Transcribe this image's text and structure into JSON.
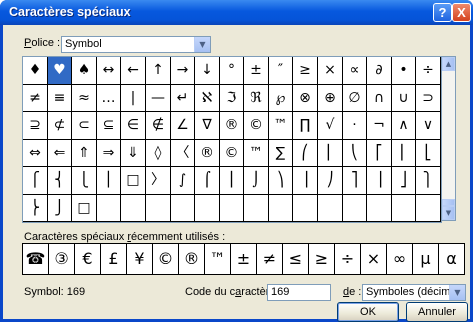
{
  "window": {
    "title": "Caractères spéciaux",
    "help_label": "?",
    "close_label": "X"
  },
  "font_row": {
    "label": "olice :",
    "label_accel": "P",
    "value": "Symbol"
  },
  "grid": {
    "rows": [
      [
        "♦",
        "♥",
        "♠",
        "↔",
        "←",
        "↑",
        "→",
        "↓",
        "°",
        "±",
        "″",
        "≥",
        "×",
        "∝",
        "∂",
        "•",
        "÷"
      ],
      [
        "≠",
        "≡",
        "≈",
        "…",
        "|",
        "—",
        "↵",
        "ℵ",
        "ℑ",
        "ℜ",
        "℘",
        "⊗",
        "⊕",
        "∅",
        "∩",
        "∪",
        "⊃"
      ],
      [
        "⊇",
        "⊄",
        "⊂",
        "⊆",
        "∈",
        "∉",
        "∠",
        "∇",
        "®",
        "©",
        "™",
        "∏",
        "√",
        "⋅",
        "¬",
        "∧",
        "∨"
      ],
      [
        "⇔",
        "⇐",
        "⇑",
        "⇒",
        "⇓",
        "◊",
        "〈",
        "®",
        "©",
        "™",
        "∑",
        "⎛",
        "⎜",
        "⎝",
        "⎡",
        "⎢",
        "⎣"
      ],
      [
        "⎧",
        "⎨",
        "⎩",
        "⎪",
        "□",
        "〉",
        "∫",
        "⌠",
        "⎮",
        "⌡",
        "⎞",
        "⎟",
        "⎠",
        "⎤",
        "⎥",
        "⎦",
        "⎫"
      ],
      [
        "⎬",
        "⎭",
        "□",
        "",
        "",
        "",
        "",
        "",
        "",
        "",
        "",
        "",
        "",
        "",
        "",
        "",
        ""
      ]
    ],
    "selected": "♥"
  },
  "recent": {
    "label_pre": "Caractères spéciaux ",
    "label_accel": "r",
    "label_post": "écemment utilisés :",
    "chars": [
      "☎",
      "③",
      "€",
      "£",
      "¥",
      "©",
      "®",
      "™",
      "±",
      "≠",
      "≤",
      "≥",
      "÷",
      "×",
      "∞",
      "µ",
      "α"
    ]
  },
  "footer": {
    "status": "Symbol: 169",
    "code_label_pre": "Code du c",
    "code_label_accel": "a",
    "code_label_post": "ractère :",
    "code_value": "169",
    "de_label_accel": "d",
    "de_label_post": "e :",
    "de_value": "Symboles (décimal)",
    "ok_label": "OK",
    "cancel_label": "Annuler"
  }
}
